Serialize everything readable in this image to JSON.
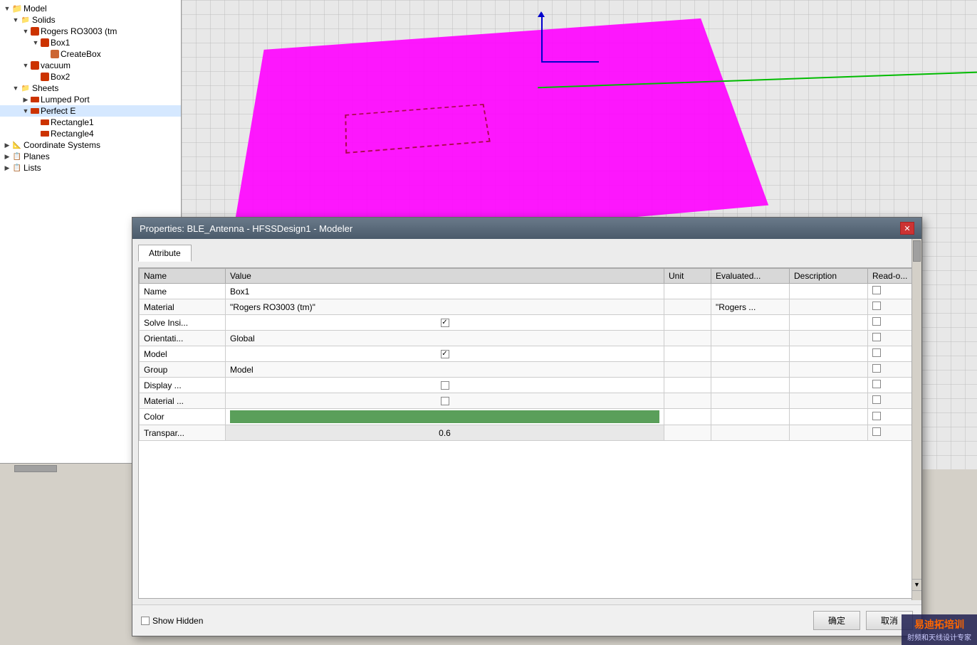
{
  "window_title": "Properties: BLE_Antenna - HFSSDesign1 - Modeler",
  "tree": {
    "model_label": "Model",
    "solids_label": "Solids",
    "rogers_label": "Rogers RO3003 (tm",
    "box1_label": "Box1",
    "createbox_label": "CreateBox",
    "vacuum_label": "vacuum",
    "box2_label": "Box2",
    "sheets_label": "Sheets",
    "lumped_port_label": "Lumped Port",
    "perfect_e_label": "Perfect E",
    "rectangle1_label": "Rectangle1",
    "rectangle4_label": "Rectangle4",
    "coord_systems_label": "Coordinate Systems",
    "planes_label": "Planes",
    "lists_label": "Lists"
  },
  "dialog": {
    "title": "Properties: BLE_Antenna - HFSSDesign1 - Modeler",
    "tab_attribute": "Attribute",
    "columns": {
      "name": "Name",
      "value": "Value",
      "unit": "Unit",
      "evaluated": "Evaluated...",
      "description": "Description",
      "readonly": "Read-o..."
    },
    "rows": [
      {
        "name": "Name",
        "value": "Box1",
        "unit": "",
        "evaluated": "",
        "description": "",
        "readonly": false
      },
      {
        "name": "Material",
        "value": "\"Rogers RO3003 (tm)\"",
        "unit": "",
        "evaluated": "\"Rogers ...",
        "description": "",
        "readonly": false
      },
      {
        "name": "Solve Insi...",
        "value": "checked",
        "unit": "",
        "evaluated": "",
        "description": "",
        "readonly": false
      },
      {
        "name": "Orientati...",
        "value": "Global",
        "unit": "",
        "evaluated": "",
        "description": "",
        "readonly": false
      },
      {
        "name": "Model",
        "value": "checked",
        "unit": "",
        "evaluated": "",
        "description": "",
        "readonly": false
      },
      {
        "name": "Group",
        "value": "Model",
        "unit": "",
        "evaluated": "",
        "description": "",
        "readonly": false
      },
      {
        "name": "Display ...",
        "value": "unchecked",
        "unit": "",
        "evaluated": "",
        "description": "",
        "readonly": false
      },
      {
        "name": "Material ...",
        "value": "unchecked",
        "unit": "",
        "evaluated": "",
        "description": "",
        "readonly": false
      },
      {
        "name": "Color",
        "value": "color_swatch",
        "unit": "",
        "evaluated": "",
        "description": "",
        "readonly": false
      },
      {
        "name": "Transpar...",
        "value": "0.6",
        "unit": "",
        "evaluated": "",
        "description": "",
        "readonly": false
      }
    ],
    "show_hidden_label": "Show Hidden",
    "ok_label": "确定",
    "cancel_label": "取消"
  },
  "watermark": {
    "title": "易迪拓培训",
    "subtitle": "射频和天线设计专家"
  }
}
